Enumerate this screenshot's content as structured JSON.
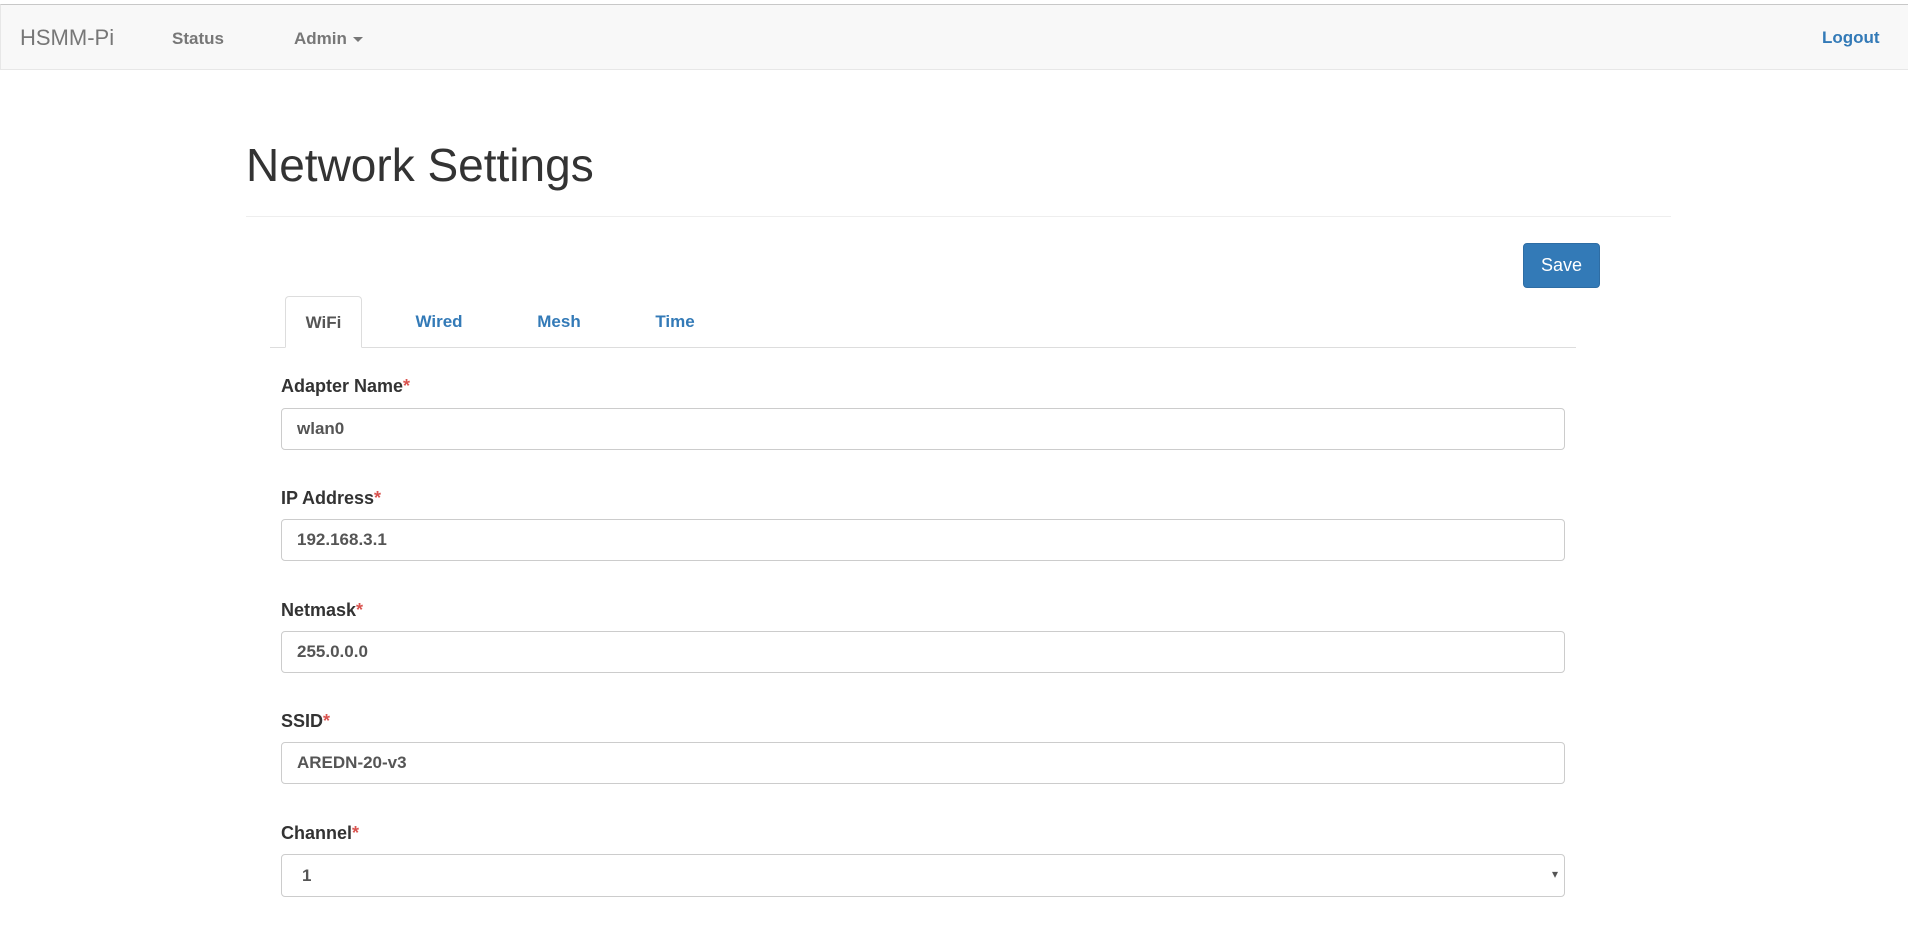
{
  "navbar": {
    "brand": "HSMM-Pi",
    "status": "Status",
    "admin": "Admin",
    "logout": "Logout"
  },
  "page": {
    "title": "Network Settings",
    "save_label": "Save"
  },
  "tabs": [
    {
      "label": "WiFi",
      "active": true
    },
    {
      "label": "Wired",
      "active": false
    },
    {
      "label": "Mesh",
      "active": false
    },
    {
      "label": "Time",
      "active": false
    }
  ],
  "form": {
    "required_marker": "*",
    "adapter_name": {
      "label": "Adapter Name",
      "value": "wlan0"
    },
    "ip_address": {
      "label": "IP Address",
      "value": "192.168.3.1"
    },
    "netmask": {
      "label": "Netmask",
      "value": "255.0.0.0"
    },
    "ssid": {
      "label": "SSID",
      "value": "AREDN-20-v3"
    },
    "channel": {
      "label": "Channel",
      "value": "1"
    }
  },
  "icons": {
    "admin_dropdown": "caret-down-icon",
    "select_arrow": "chevron-down-icon"
  },
  "colors": {
    "link": "#337ab7",
    "primary_button": "#337ab7",
    "required": "#d9534f",
    "navbar_bg": "#f8f8f8"
  }
}
